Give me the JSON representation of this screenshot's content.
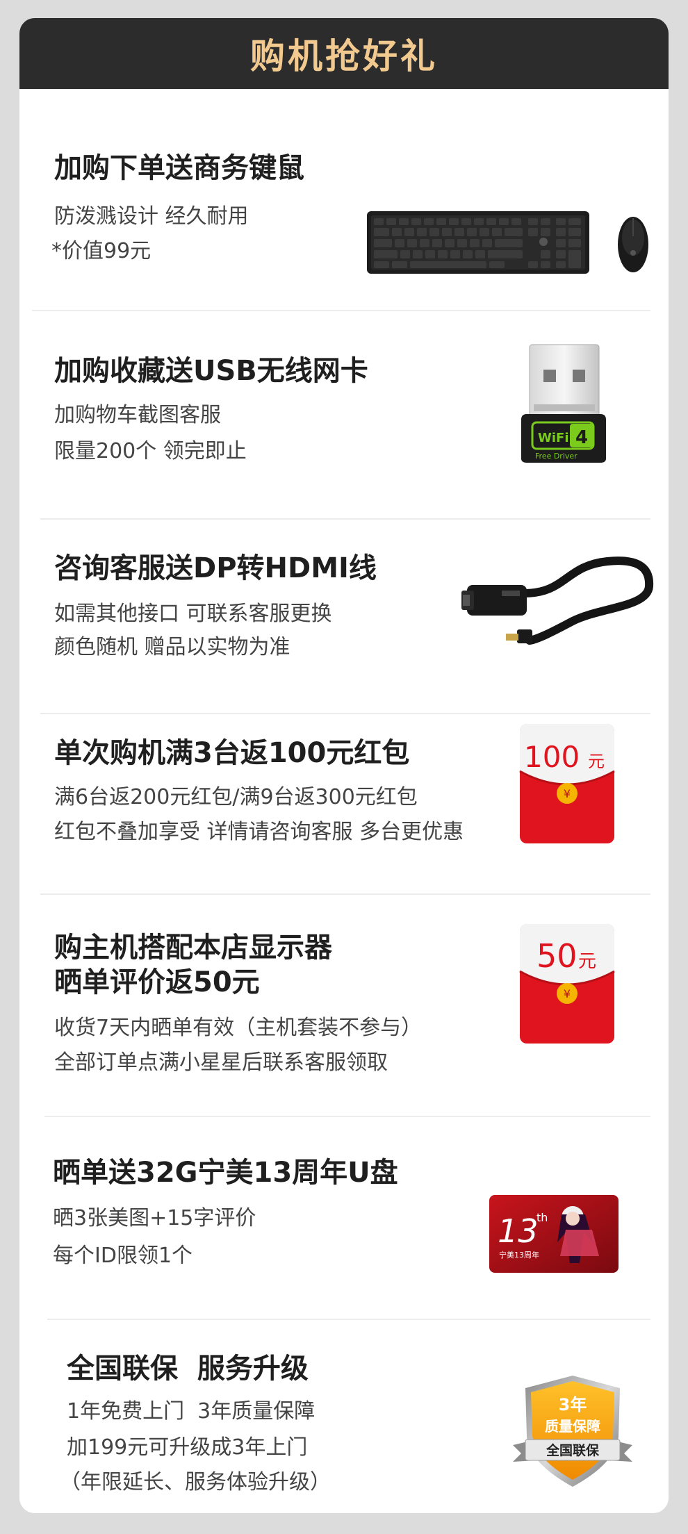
{
  "header": {
    "title": "购机抢好礼"
  },
  "items": [
    {
      "title": "加购下单送商务键鼠",
      "lines": [
        "防泼溅设计 经久耐用",
        "*价值99元"
      ],
      "image": "keyboard-mouse"
    },
    {
      "title": "加购收藏送USB无线网卡",
      "lines": [
        "加购物车截图客服",
        "限量200个 领完即止"
      ],
      "image": "usb-wifi-adapter",
      "image_text": {
        "wifi": "WiFi",
        "num": "4",
        "driver": "Free Driver"
      }
    },
    {
      "title": "咨询客服送DP转HDMI线",
      "lines": [
        "如需其他接口 可联系客服更换",
        "颜色随机 赠品以实物为准"
      ],
      "image": "dp-hdmi-cable"
    },
    {
      "title": "单次购机满3台返100元红包",
      "lines": [
        "满6台返200元红包/满9台返300元红包",
        "红包不叠加享受 详情请咨询客服 多台更优惠"
      ],
      "image": "red-envelope",
      "amount": "100",
      "unit": "元",
      "symbol": "¥"
    },
    {
      "title": "购主机搭配本店显示器",
      "title2": "晒单评价返50元",
      "lines": [
        "收货7天内晒单有效（主机套装不参与）",
        "全部订单点满小星星后联系客服领取"
      ],
      "image": "red-envelope",
      "amount": "50",
      "unit": "元",
      "symbol": "¥"
    },
    {
      "title": "晒单送32G宁美13周年U盘",
      "lines": [
        "晒3张美图+15字评价",
        "每个ID限领1个"
      ],
      "image": "usb-drive-13th",
      "image_text": {
        "num": "13",
        "sup": "th",
        "sub": "宁美13周年"
      }
    },
    {
      "title": "全国联保  服务升级",
      "lines": [
        "1年免费上门  3年质量保障",
        "加199元可升级成3年上门",
        "（年限延长、服务体验升级）"
      ],
      "image": "warranty-badge",
      "badge": {
        "years": "3年",
        "label": "质量保障",
        "ribbon": "全国联保"
      }
    }
  ],
  "colors": {
    "banner_bg": "#2c2c2c",
    "banner_text": "#f2c98f",
    "red": "#e0141e",
    "gold": "#f4b400"
  }
}
